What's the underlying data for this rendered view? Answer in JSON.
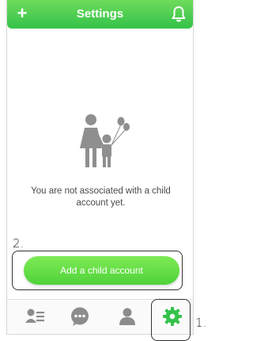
{
  "header": {
    "title": "Settings",
    "left_icon": "plus-icon",
    "right_icon": "bell-icon",
    "plus_glyph": "+"
  },
  "empty_state": {
    "illustration": "parent-and-child-with-balloons-icon",
    "message": "You are not associated with a child account yet."
  },
  "primary_action": {
    "label": "Add a child account"
  },
  "tabbar": {
    "tabs": [
      {
        "name": "contacts",
        "icon": "contact-list-icon",
        "active": false
      },
      {
        "name": "messages",
        "icon": "chat-bubble-icon",
        "active": false
      },
      {
        "name": "profile",
        "icon": "person-icon",
        "active": false
      },
      {
        "name": "settings",
        "icon": "gear-icon",
        "active": true
      }
    ]
  },
  "annotations": {
    "callout_1": "1.",
    "callout_2": "2."
  },
  "colors": {
    "brand_green": "#4fd23a",
    "icon_gray": "#8c8c8c",
    "active_tab": "#34c24a"
  }
}
